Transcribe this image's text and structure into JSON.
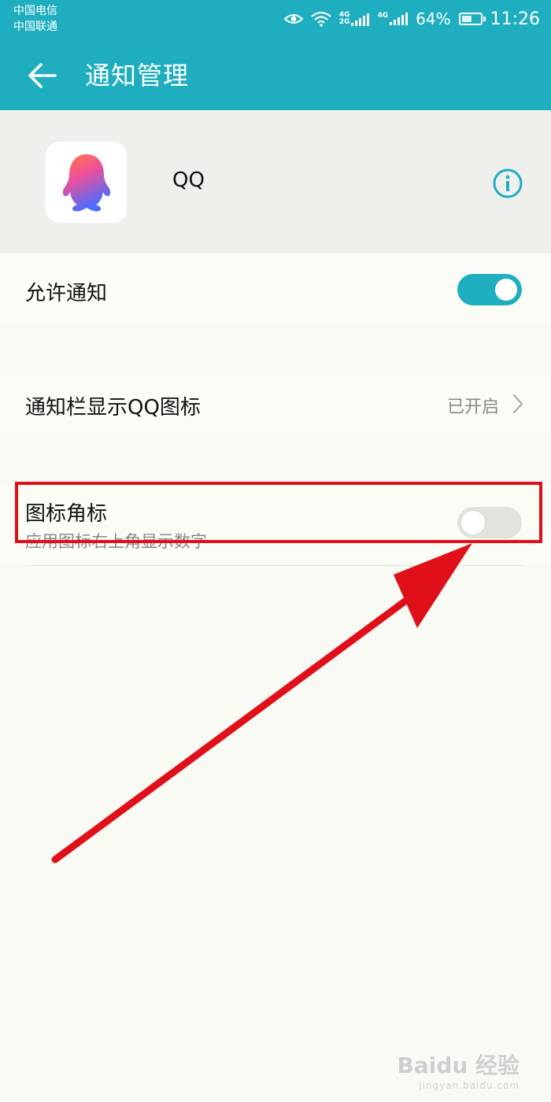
{
  "status_bar": {
    "carrier_1": "中国电信",
    "carrier_2": "中国联通",
    "battery_pct": "64%",
    "battery_level": 0.64,
    "time": "11:26",
    "net_1": "4G",
    "net_1b": "2G",
    "net_2": "4G",
    "icons": [
      "eye-comfort-icon",
      "wifi-icon",
      "signal-icon",
      "battery-icon"
    ]
  },
  "header": {
    "title": "通知管理"
  },
  "app": {
    "name": "QQ"
  },
  "settings": {
    "allow_notification": {
      "label": "允许通知",
      "enabled": true
    },
    "status_bar_icon": {
      "label": "通知栏显示QQ图标",
      "value": "已开启"
    },
    "badge": {
      "label": "图标角标",
      "description": "应用图标右上角显示数字",
      "enabled": false
    }
  },
  "colors": {
    "accent": "#1eaec0",
    "highlight": "#e0101a"
  },
  "watermark": {
    "brand": "Baidu 经验",
    "url": "jingyan.baidu.com"
  }
}
